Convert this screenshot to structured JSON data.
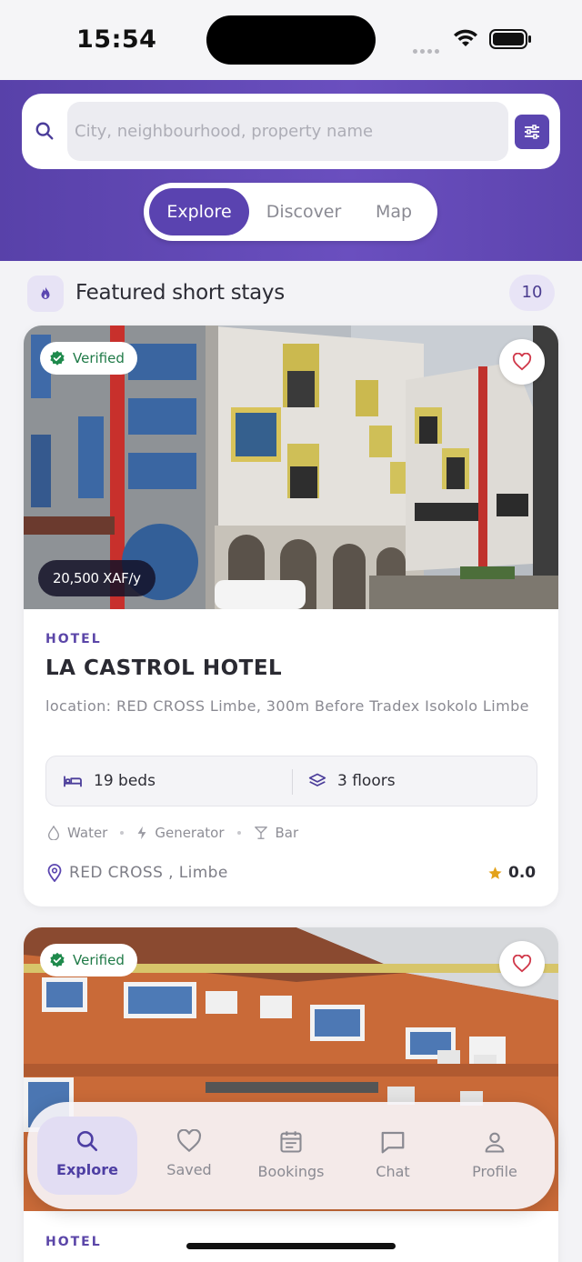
{
  "status_bar": {
    "time": "15:54"
  },
  "search": {
    "placeholder": "City, neighbourhood, property name"
  },
  "tabs": {
    "explore": "Explore",
    "discover": "Discover",
    "map": "Map"
  },
  "featured": {
    "title": "Featured short stays",
    "count": "10"
  },
  "listings": [
    {
      "badge": "Verified",
      "price": "20,500 XAF/y",
      "type": "HOTEL",
      "name": "LA CASTROL HOTEL",
      "location": "location: RED CROSS Limbe, 300m Before Tradex Isokolo Limbe",
      "beds": "19 beds",
      "floors": "3 floors",
      "amenities": [
        "Water",
        "Generator",
        "Bar"
      ],
      "address": "RED CROSS , Limbe",
      "rating": "0.0"
    },
    {
      "badge": "Verified",
      "type": "HOTEL"
    }
  ],
  "bottom_nav": {
    "explore": "Explore",
    "saved": "Saved",
    "bookings": "Bookings",
    "chat": "Chat",
    "profile": "Profile"
  },
  "colors": {
    "brand": "#5b46b0",
    "verified_green": "#1f7a47",
    "star": "#e3a21a",
    "heart": "#d0384a"
  }
}
